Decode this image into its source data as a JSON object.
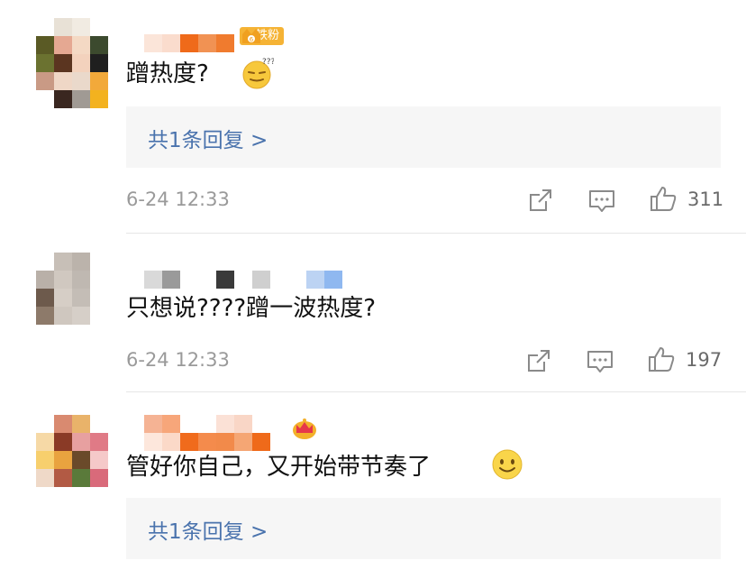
{
  "comments": [
    {
      "username": "",
      "badge_label": "铁粉",
      "text": "蹭热度?",
      "emoji": "thinking-face-emoji",
      "reply_link": "共1条回复 >",
      "timestamp": "6-24 12:33",
      "likes": "311"
    },
    {
      "username": "",
      "text": "只想说????蹭一波热度?",
      "timestamp": "6-24 12:33",
      "likes": "197"
    },
    {
      "username": "",
      "badge": "crown-badge-icon",
      "text": "管好你自己，又开始带节奏了",
      "emoji": "smile-emoji",
      "reply_link": "共1条回复 >"
    }
  ],
  "colors": {
    "link": "#4a73ad",
    "meta": "#9a9a9a",
    "reply_bg": "#f6f6f6",
    "badge": "#f5b335"
  },
  "icons": [
    "share-icon",
    "comment-icon",
    "like-icon"
  ]
}
